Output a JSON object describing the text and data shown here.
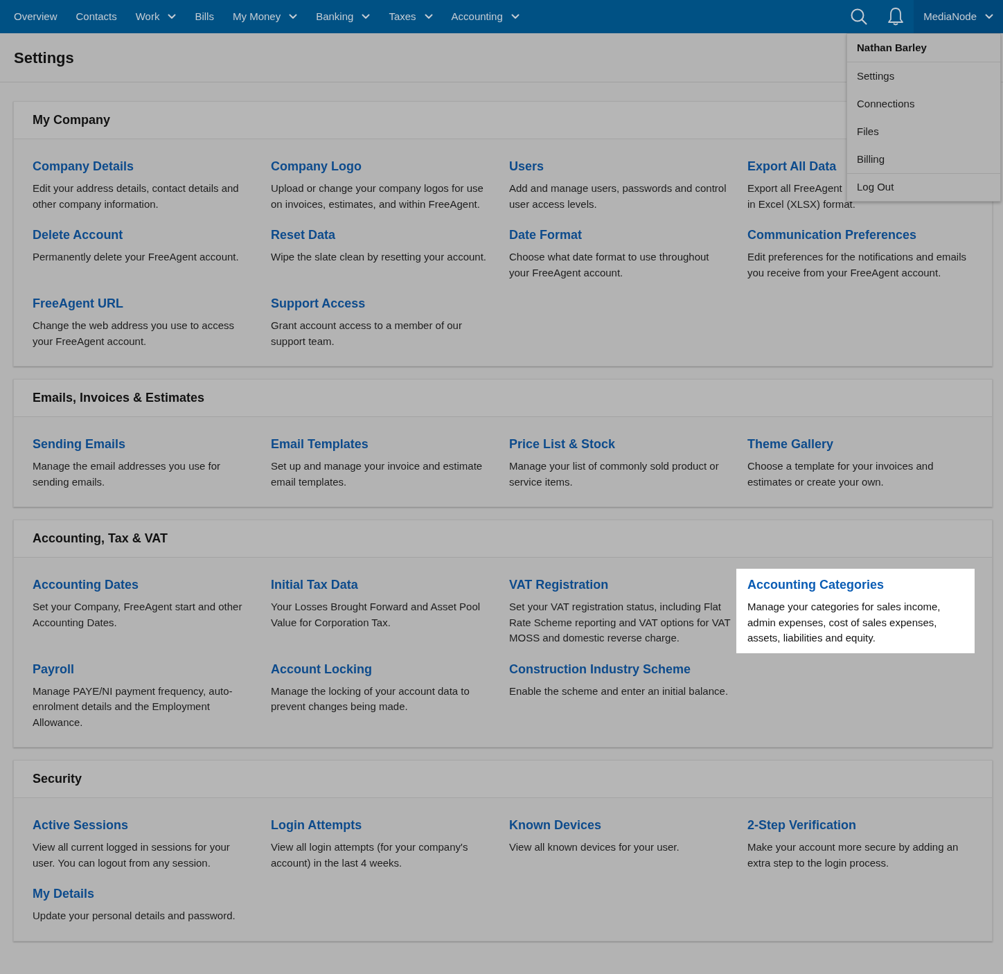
{
  "nav": {
    "items": [
      {
        "label": "Overview",
        "dropdown": false
      },
      {
        "label": "Contacts",
        "dropdown": false
      },
      {
        "label": "Work",
        "dropdown": true
      },
      {
        "label": "Bills",
        "dropdown": false
      },
      {
        "label": "My Money",
        "dropdown": true
      },
      {
        "label": "Banking",
        "dropdown": true
      },
      {
        "label": "Taxes",
        "dropdown": true
      },
      {
        "label": "Accounting",
        "dropdown": true
      }
    ],
    "account": {
      "label": "MediaNode",
      "open": true
    }
  },
  "page_title": "Settings",
  "sections": [
    {
      "title": "My Company",
      "items": [
        {
          "title": "Company Details",
          "description": "Edit your address details, contact details and other company information.",
          "highlighted": false
        },
        {
          "title": "Company Logo",
          "description": "Upload or change your company logos for use on invoices, estimates, and within FreeAgent.",
          "highlighted": false
        },
        {
          "title": "Users",
          "description": "Add and manage users, passwords and control user access levels.",
          "highlighted": false
        },
        {
          "title": "Export All Data",
          "description": "Export all FreeAgent\nin Excel (XLSX) format.",
          "highlighted": false
        },
        {
          "title": "Delete Account",
          "description": "Permanently delete your FreeAgent account.",
          "highlighted": false
        },
        {
          "title": "Reset Data",
          "description": "Wipe the slate clean by resetting your account.",
          "highlighted": false
        },
        {
          "title": "Date Format",
          "description": "Choose what date format to use throughout your FreeAgent account.",
          "highlighted": false
        },
        {
          "title": "Communication Preferences",
          "description": "Edit preferences for the notifications and emails you receive from your FreeAgent account.",
          "highlighted": false
        },
        {
          "title": "FreeAgent URL",
          "description": "Change the web address you use to access your FreeAgent account.",
          "highlighted": false
        },
        {
          "title": "Support Access",
          "description": "Grant account access to a member of our support team.",
          "highlighted": false
        }
      ]
    },
    {
      "title": "Emails, Invoices & Estimates",
      "items": [
        {
          "title": "Sending Emails",
          "description": "Manage the email addresses you use for sending emails.",
          "highlighted": false
        },
        {
          "title": "Email Templates",
          "description": "Set up and manage your invoice and estimate email templates.",
          "highlighted": false
        },
        {
          "title": "Price List & Stock",
          "description": "Manage your list of commonly sold product or service items.",
          "highlighted": false
        },
        {
          "title": "Theme Gallery",
          "description": "Choose a template for your invoices and estimates or create your own.",
          "highlighted": false
        }
      ]
    },
    {
      "title": "Accounting, Tax & VAT",
      "items": [
        {
          "title": "Accounting Dates",
          "description": "Set your Company, FreeAgent start and other Accounting Dates.",
          "highlighted": false
        },
        {
          "title": "Initial Tax Data",
          "description": "Your Losses Brought Forward and Asset Pool Value for Corporation Tax.",
          "highlighted": false
        },
        {
          "title": "VAT Registration",
          "description": "Set your VAT registration status, including Flat Rate Scheme reporting and VAT options for VAT MOSS and domestic reverse charge.",
          "highlighted": false
        },
        {
          "title": "Accounting Categories",
          "description": "Manage your categories for sales income, admin expenses, cost of sales expenses, assets, liabilities and equity.",
          "highlighted": true
        },
        {
          "title": "Payroll",
          "description": "Manage PAYE/NI payment frequency, auto-enrolment details and the Employment Allowance.",
          "highlighted": false
        },
        {
          "title": "Account Locking",
          "description": "Manage the locking of your account data to prevent changes being made.",
          "highlighted": false
        },
        {
          "title": "Construction Industry Scheme",
          "description": "Enable the scheme and enter an initial balance.",
          "highlighted": false
        }
      ]
    },
    {
      "title": "Security",
      "items": [
        {
          "title": "Active Sessions",
          "description": "View all current logged in sessions for your user. You can logout from any session.",
          "highlighted": false
        },
        {
          "title": "Login Attempts",
          "description": "View all login attempts (for your company's account) in the last 4 weeks.",
          "highlighted": false
        },
        {
          "title": "Known Devices",
          "description": "View all known devices for your user.",
          "highlighted": false
        },
        {
          "title": "2-Step Verification",
          "description": "Make your account more secure by adding an extra step to the login process.",
          "highlighted": false
        },
        {
          "title": "My Details",
          "description": "Update your personal details and password.",
          "highlighted": false
        }
      ]
    }
  ],
  "account_menu": {
    "user": "Nathan Barley",
    "items": [
      {
        "label": "Settings",
        "divider_before": false
      },
      {
        "label": "Connections",
        "divider_before": false
      },
      {
        "label": "Files",
        "divider_before": false
      },
      {
        "label": "Billing",
        "divider_before": false
      },
      {
        "label": "Log Out",
        "divider_before": true
      }
    ]
  }
}
